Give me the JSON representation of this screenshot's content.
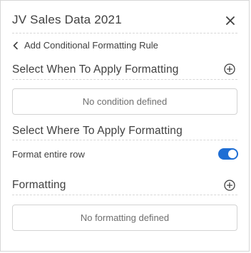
{
  "header": {
    "title": "JV Sales Data 2021",
    "close_icon": "close-icon"
  },
  "nav": {
    "back_label": "Add Conditional Formatting Rule",
    "back_icon": "chevron-left-icon"
  },
  "when_section": {
    "title": "Select When To Apply Formatting",
    "add_icon": "plus-circle-icon",
    "empty_text": "No condition defined"
  },
  "where_section": {
    "title": "Select Where To Apply Formatting",
    "toggle_label": "Format entire row",
    "toggle_on": true
  },
  "formatting_section": {
    "title": "Formatting",
    "add_icon": "plus-circle-icon",
    "empty_text": "No formatting defined"
  },
  "colors": {
    "accent": "#1f6ed4",
    "text": "#404040",
    "muted": "#6f6f6f",
    "border": "#d3d3d3"
  }
}
